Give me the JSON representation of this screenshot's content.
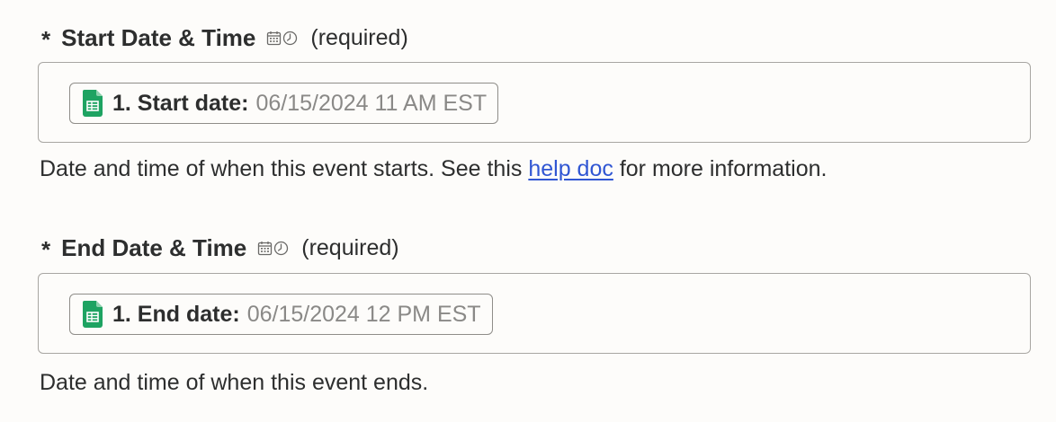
{
  "fields": [
    {
      "required_marker": "*",
      "label": "Start Date & Time",
      "type_icons": [
        "calendar-icon",
        "clock-icon"
      ],
      "required_text": "(required)",
      "pill": {
        "icon": "google-sheets-icon",
        "label": "1. Start date:",
        "value": "06/15/2024 11 AM EST"
      },
      "help": {
        "before": "Date and time of when this event starts. See this ",
        "link": "help doc",
        "after": " for more information."
      }
    },
    {
      "required_marker": "*",
      "label": "End Date & Time",
      "type_icons": [
        "calendar-icon",
        "clock-icon"
      ],
      "required_text": "(required)",
      "pill": {
        "icon": "google-sheets-icon",
        "label": "1. End date:",
        "value": "06/15/2024 12 PM EST"
      },
      "help": {
        "before": "Date and time of when this event ends.",
        "link": "",
        "after": ""
      }
    }
  ],
  "colors": {
    "background": "#fdfcfa",
    "text": "#2d2e2e",
    "muted_value": "#8a8987",
    "link": "#3056d3",
    "border": "#a8a6a2",
    "sheets_green": "#1ea362"
  }
}
